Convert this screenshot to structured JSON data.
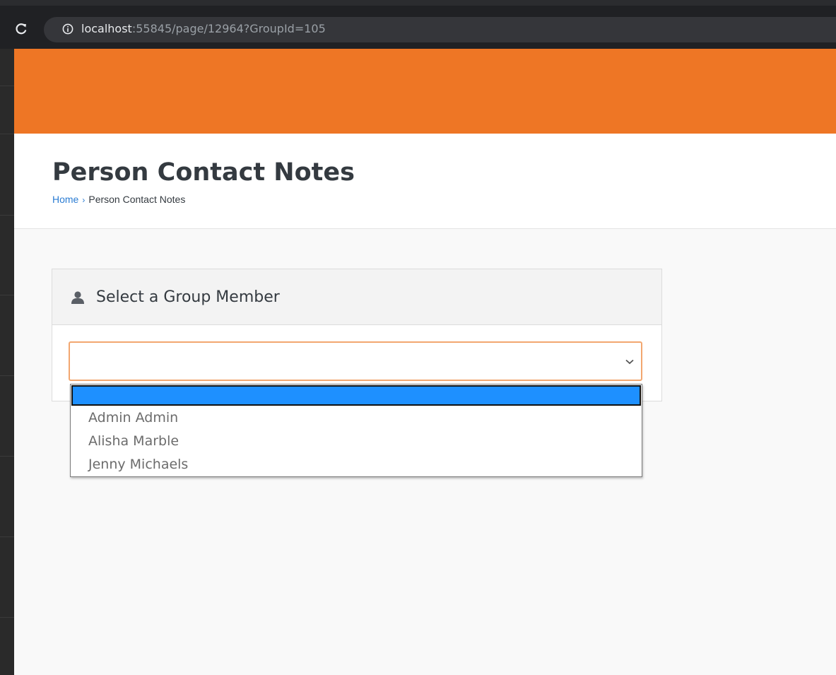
{
  "browser": {
    "url_host": "localhost",
    "url_rest": ":55845/page/12964?GroupId=105"
  },
  "page": {
    "title": "Person Contact Notes",
    "breadcrumb": {
      "home": "Home",
      "separator": "›",
      "current": "Person Contact Notes"
    }
  },
  "panel": {
    "title": "Select a Group Member",
    "icon": "user-icon"
  },
  "select": {
    "value": "",
    "options": [
      "",
      "Admin Admin",
      "Alisha Marble",
      "Jenny Michaels"
    ],
    "highlighted_index": 0
  },
  "colors": {
    "header": "#ee7625",
    "link": "#2b7cd3",
    "focus_border": "#f2a770",
    "highlight": "#1e90ff"
  }
}
